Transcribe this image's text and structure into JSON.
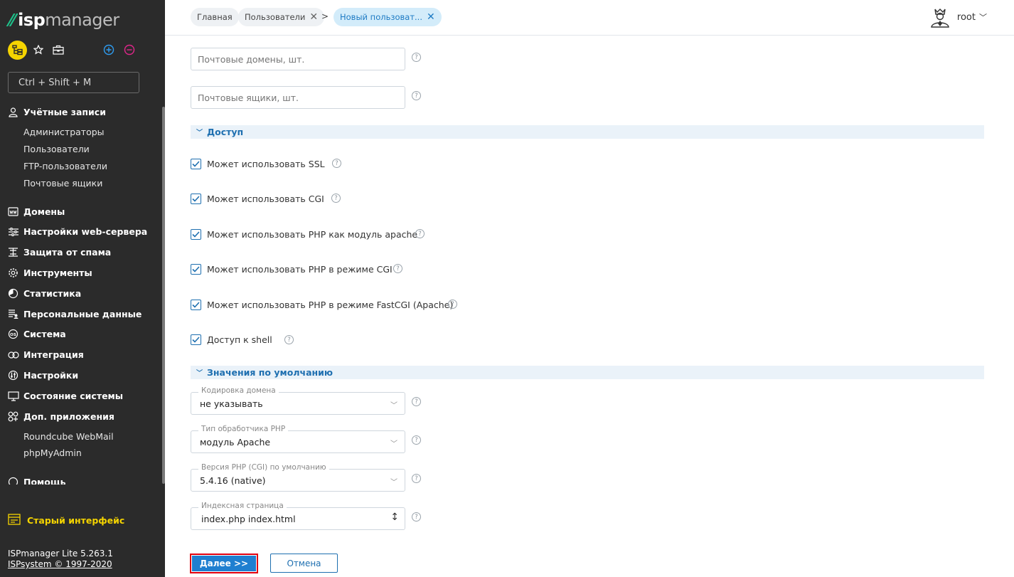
{
  "app": {
    "logo_bold": "isp",
    "logo_light": "manager",
    "brand_color": "#1ec28b",
    "accent_color": "#1f7fd0",
    "highlight_color": "#f5d400"
  },
  "sidebar": {
    "search_placeholder": "Ctrl + Shift + M",
    "groups": [
      {
        "label": "Учётные записи",
        "icon": "users-icon",
        "items": [
          "Администраторы",
          "Пользователи",
          "FTP-пользователи",
          "Почтовые ящики"
        ]
      },
      {
        "label": "Домены",
        "icon": "www-icon"
      },
      {
        "label": "Настройки web-сервера",
        "icon": "sliders-icon"
      },
      {
        "label": "Защита от спама",
        "icon": "spam-filter-icon"
      },
      {
        "label": "Инструменты",
        "icon": "gear-icon"
      },
      {
        "label": "Статистика",
        "icon": "pie-chart-icon"
      },
      {
        "label": "Персональные данные",
        "icon": "personal-data-icon"
      },
      {
        "label": "Система",
        "icon": "os-icon"
      },
      {
        "label": "Интеграция",
        "icon": "integration-icon"
      },
      {
        "label": "Настройки",
        "icon": "settings-icon"
      },
      {
        "label": "Состояние системы",
        "icon": "monitor-icon"
      },
      {
        "label": "Доп. приложения",
        "icon": "apps-icon",
        "items": [
          "Roundcube WebMail",
          "phpMyAdmin"
        ]
      },
      {
        "label": "Помощь",
        "icon": "help-icon"
      }
    ],
    "old_interface": "Старый интерфейс",
    "version": "ISPmanager Lite 5.263.1",
    "copyright": "ISPsystem © 1997-2020"
  },
  "header": {
    "breadcrumbs": [
      "Главная",
      "Пользователи",
      "Новый пользоват..."
    ],
    "separator": ">",
    "user": "root"
  },
  "form": {
    "mail_domains_placeholder": "Почтовые домены, шт.",
    "mailboxes_placeholder": "Почтовые ящики, шт.",
    "section_access": "Доступ",
    "checkboxes": [
      {
        "label": "Может использовать SSL",
        "checked": true
      },
      {
        "label": "Может использовать CGI",
        "checked": true
      },
      {
        "label": "Может использовать PHP как модуль apache",
        "checked": true
      },
      {
        "label": "Может использовать PHP в режиме CGI",
        "checked": true
      },
      {
        "label": "Может использовать PHP в режиме FastCGI (Apache)",
        "checked": true
      },
      {
        "label": "Доступ к shell",
        "checked": true
      }
    ],
    "section_defaults": "Значения по умолчанию",
    "domain_encoding_label": "Кодировка домена",
    "domain_encoding_value": "не указывать",
    "php_handler_label": "Тип обработчика PHP",
    "php_handler_value": "модуль Apache",
    "php_version_label": "Версия PHP (CGI) по умолчанию",
    "php_version_value": "5.4.16 (native)",
    "index_page_label": "Индексная страница",
    "index_page_value": "index.php index.html",
    "help_glyph": "?",
    "next_button": "Далее >>",
    "cancel_button": "Отмена"
  }
}
